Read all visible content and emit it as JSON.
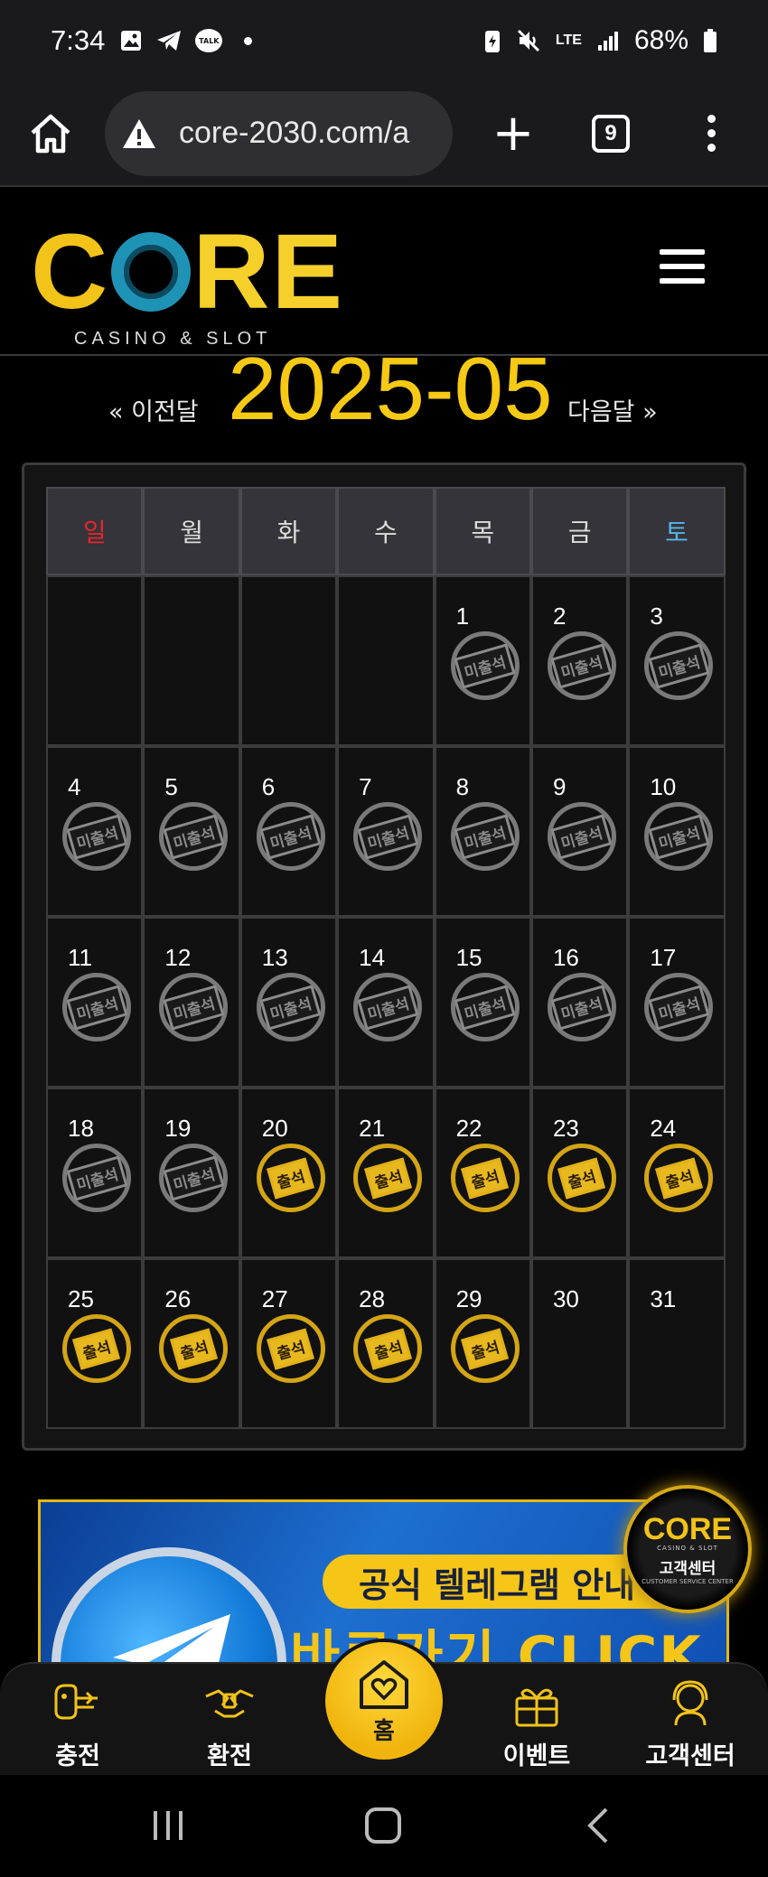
{
  "status_bar": {
    "time": "7:34",
    "battery": "68%",
    "network": "LTE",
    "icons": [
      "image-icon",
      "telegram-icon",
      "talk-icon",
      "dot-icon",
      "battery-saver-icon",
      "mute-icon",
      "lte-icon",
      "signal-icon",
      "battery-icon"
    ],
    "talk_label": "TALK"
  },
  "browser": {
    "url": "core-2030.com/a",
    "tab_count": "9"
  },
  "site": {
    "logo_text": "CORE",
    "logo_sub": "CASINO & SLOT"
  },
  "calendar": {
    "prev_label": "« 이전달",
    "month": "2025-05",
    "next_label": "다음달 »",
    "weekdays": [
      {
        "label": "일",
        "color": "#e8252b"
      },
      {
        "label": "월",
        "color": "#dddddd"
      },
      {
        "label": "화",
        "color": "#dddddd"
      },
      {
        "label": "수",
        "color": "#dddddd"
      },
      {
        "label": "목",
        "color": "#dddddd"
      },
      {
        "label": "금",
        "color": "#dddddd"
      },
      {
        "label": "토",
        "color": "#5ab4ea"
      }
    ],
    "absent_label": "미출석",
    "present_label": "출석",
    "weeks": [
      [
        null,
        null,
        null,
        null,
        {
          "day": "1",
          "status": "absent"
        },
        {
          "day": "2",
          "status": "absent"
        },
        {
          "day": "3",
          "status": "absent"
        }
      ],
      [
        {
          "day": "4",
          "status": "absent"
        },
        {
          "day": "5",
          "status": "absent"
        },
        {
          "day": "6",
          "status": "absent"
        },
        {
          "day": "7",
          "status": "absent"
        },
        {
          "day": "8",
          "status": "absent"
        },
        {
          "day": "9",
          "status": "absent"
        },
        {
          "day": "10",
          "status": "absent"
        }
      ],
      [
        {
          "day": "11",
          "status": "absent"
        },
        {
          "day": "12",
          "status": "absent"
        },
        {
          "day": "13",
          "status": "absent"
        },
        {
          "day": "14",
          "status": "absent"
        },
        {
          "day": "15",
          "status": "absent"
        },
        {
          "day": "16",
          "status": "absent"
        },
        {
          "day": "17",
          "status": "absent"
        }
      ],
      [
        {
          "day": "18",
          "status": "absent"
        },
        {
          "day": "19",
          "status": "absent"
        },
        {
          "day": "20",
          "status": "present"
        },
        {
          "day": "21",
          "status": "present"
        },
        {
          "day": "22",
          "status": "present"
        },
        {
          "day": "23",
          "status": "present"
        },
        {
          "day": "24",
          "status": "present"
        }
      ],
      [
        {
          "day": "25",
          "status": "present"
        },
        {
          "day": "26",
          "status": "present"
        },
        {
          "day": "27",
          "status": "present"
        },
        {
          "day": "28",
          "status": "present"
        },
        {
          "day": "29",
          "status": "present"
        },
        {
          "day": "30",
          "status": "none"
        },
        {
          "day": "31",
          "status": "none"
        }
      ]
    ]
  },
  "banner": {
    "headline": "공식 텔레그램 안내",
    "cta": "바로가기 CLICK"
  },
  "cs_badge": {
    "logo": "CORE",
    "sub": "CASINO & SLOT",
    "label": "고객센터",
    "eng": "CUSTOMER SERVICE CENTER"
  },
  "bottom_nav": {
    "charge": "충전",
    "exchange": "환전",
    "home": "홈",
    "event": "이벤트",
    "support": "고객센터"
  },
  "colors": {
    "accent": "#f6c914",
    "background": "#000000",
    "absent_stamp": "#8b8b8b",
    "present_stamp": "#e8b91e"
  }
}
